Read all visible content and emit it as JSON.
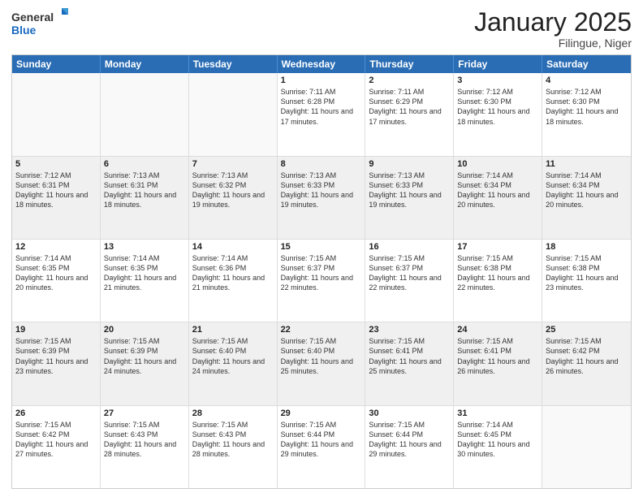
{
  "logo": {
    "line1": "General",
    "line2": "Blue"
  },
  "title": "January 2025",
  "location": "Filingue, Niger",
  "days": [
    "Sunday",
    "Monday",
    "Tuesday",
    "Wednesday",
    "Thursday",
    "Friday",
    "Saturday"
  ],
  "weeks": [
    [
      {
        "day": "",
        "sunrise": "",
        "sunset": "",
        "daylight": "",
        "empty": true
      },
      {
        "day": "",
        "sunrise": "",
        "sunset": "",
        "daylight": "",
        "empty": true
      },
      {
        "day": "",
        "sunrise": "",
        "sunset": "",
        "daylight": "",
        "empty": true
      },
      {
        "day": "1",
        "sunrise": "Sunrise: 7:11 AM",
        "sunset": "Sunset: 6:28 PM",
        "daylight": "Daylight: 11 hours and 17 minutes.",
        "empty": false
      },
      {
        "day": "2",
        "sunrise": "Sunrise: 7:11 AM",
        "sunset": "Sunset: 6:29 PM",
        "daylight": "Daylight: 11 hours and 17 minutes.",
        "empty": false
      },
      {
        "day": "3",
        "sunrise": "Sunrise: 7:12 AM",
        "sunset": "Sunset: 6:30 PM",
        "daylight": "Daylight: 11 hours and 18 minutes.",
        "empty": false
      },
      {
        "day": "4",
        "sunrise": "Sunrise: 7:12 AM",
        "sunset": "Sunset: 6:30 PM",
        "daylight": "Daylight: 11 hours and 18 minutes.",
        "empty": false
      }
    ],
    [
      {
        "day": "5",
        "sunrise": "Sunrise: 7:12 AM",
        "sunset": "Sunset: 6:31 PM",
        "daylight": "Daylight: 11 hours and 18 minutes.",
        "empty": false
      },
      {
        "day": "6",
        "sunrise": "Sunrise: 7:13 AM",
        "sunset": "Sunset: 6:31 PM",
        "daylight": "Daylight: 11 hours and 18 minutes.",
        "empty": false
      },
      {
        "day": "7",
        "sunrise": "Sunrise: 7:13 AM",
        "sunset": "Sunset: 6:32 PM",
        "daylight": "Daylight: 11 hours and 19 minutes.",
        "empty": false
      },
      {
        "day": "8",
        "sunrise": "Sunrise: 7:13 AM",
        "sunset": "Sunset: 6:33 PM",
        "daylight": "Daylight: 11 hours and 19 minutes.",
        "empty": false
      },
      {
        "day": "9",
        "sunrise": "Sunrise: 7:13 AM",
        "sunset": "Sunset: 6:33 PM",
        "daylight": "Daylight: 11 hours and 19 minutes.",
        "empty": false
      },
      {
        "day": "10",
        "sunrise": "Sunrise: 7:14 AM",
        "sunset": "Sunset: 6:34 PM",
        "daylight": "Daylight: 11 hours and 20 minutes.",
        "empty": false
      },
      {
        "day": "11",
        "sunrise": "Sunrise: 7:14 AM",
        "sunset": "Sunset: 6:34 PM",
        "daylight": "Daylight: 11 hours and 20 minutes.",
        "empty": false
      }
    ],
    [
      {
        "day": "12",
        "sunrise": "Sunrise: 7:14 AM",
        "sunset": "Sunset: 6:35 PM",
        "daylight": "Daylight: 11 hours and 20 minutes.",
        "empty": false
      },
      {
        "day": "13",
        "sunrise": "Sunrise: 7:14 AM",
        "sunset": "Sunset: 6:35 PM",
        "daylight": "Daylight: 11 hours and 21 minutes.",
        "empty": false
      },
      {
        "day": "14",
        "sunrise": "Sunrise: 7:14 AM",
        "sunset": "Sunset: 6:36 PM",
        "daylight": "Daylight: 11 hours and 21 minutes.",
        "empty": false
      },
      {
        "day": "15",
        "sunrise": "Sunrise: 7:15 AM",
        "sunset": "Sunset: 6:37 PM",
        "daylight": "Daylight: 11 hours and 22 minutes.",
        "empty": false
      },
      {
        "day": "16",
        "sunrise": "Sunrise: 7:15 AM",
        "sunset": "Sunset: 6:37 PM",
        "daylight": "Daylight: 11 hours and 22 minutes.",
        "empty": false
      },
      {
        "day": "17",
        "sunrise": "Sunrise: 7:15 AM",
        "sunset": "Sunset: 6:38 PM",
        "daylight": "Daylight: 11 hours and 22 minutes.",
        "empty": false
      },
      {
        "day": "18",
        "sunrise": "Sunrise: 7:15 AM",
        "sunset": "Sunset: 6:38 PM",
        "daylight": "Daylight: 11 hours and 23 minutes.",
        "empty": false
      }
    ],
    [
      {
        "day": "19",
        "sunrise": "Sunrise: 7:15 AM",
        "sunset": "Sunset: 6:39 PM",
        "daylight": "Daylight: 11 hours and 23 minutes.",
        "empty": false
      },
      {
        "day": "20",
        "sunrise": "Sunrise: 7:15 AM",
        "sunset": "Sunset: 6:39 PM",
        "daylight": "Daylight: 11 hours and 24 minutes.",
        "empty": false
      },
      {
        "day": "21",
        "sunrise": "Sunrise: 7:15 AM",
        "sunset": "Sunset: 6:40 PM",
        "daylight": "Daylight: 11 hours and 24 minutes.",
        "empty": false
      },
      {
        "day": "22",
        "sunrise": "Sunrise: 7:15 AM",
        "sunset": "Sunset: 6:40 PM",
        "daylight": "Daylight: 11 hours and 25 minutes.",
        "empty": false
      },
      {
        "day": "23",
        "sunrise": "Sunrise: 7:15 AM",
        "sunset": "Sunset: 6:41 PM",
        "daylight": "Daylight: 11 hours and 25 minutes.",
        "empty": false
      },
      {
        "day": "24",
        "sunrise": "Sunrise: 7:15 AM",
        "sunset": "Sunset: 6:41 PM",
        "daylight": "Daylight: 11 hours and 26 minutes.",
        "empty": false
      },
      {
        "day": "25",
        "sunrise": "Sunrise: 7:15 AM",
        "sunset": "Sunset: 6:42 PM",
        "daylight": "Daylight: 11 hours and 26 minutes.",
        "empty": false
      }
    ],
    [
      {
        "day": "26",
        "sunrise": "Sunrise: 7:15 AM",
        "sunset": "Sunset: 6:42 PM",
        "daylight": "Daylight: 11 hours and 27 minutes.",
        "empty": false
      },
      {
        "day": "27",
        "sunrise": "Sunrise: 7:15 AM",
        "sunset": "Sunset: 6:43 PM",
        "daylight": "Daylight: 11 hours and 28 minutes.",
        "empty": false
      },
      {
        "day": "28",
        "sunrise": "Sunrise: 7:15 AM",
        "sunset": "Sunset: 6:43 PM",
        "daylight": "Daylight: 11 hours and 28 minutes.",
        "empty": false
      },
      {
        "day": "29",
        "sunrise": "Sunrise: 7:15 AM",
        "sunset": "Sunset: 6:44 PM",
        "daylight": "Daylight: 11 hours and 29 minutes.",
        "empty": false
      },
      {
        "day": "30",
        "sunrise": "Sunrise: 7:15 AM",
        "sunset": "Sunset: 6:44 PM",
        "daylight": "Daylight: 11 hours and 29 minutes.",
        "empty": false
      },
      {
        "day": "31",
        "sunrise": "Sunrise: 7:14 AM",
        "sunset": "Sunset: 6:45 PM",
        "daylight": "Daylight: 11 hours and 30 minutes.",
        "empty": false
      },
      {
        "day": "",
        "sunrise": "",
        "sunset": "",
        "daylight": "",
        "empty": true
      }
    ]
  ]
}
